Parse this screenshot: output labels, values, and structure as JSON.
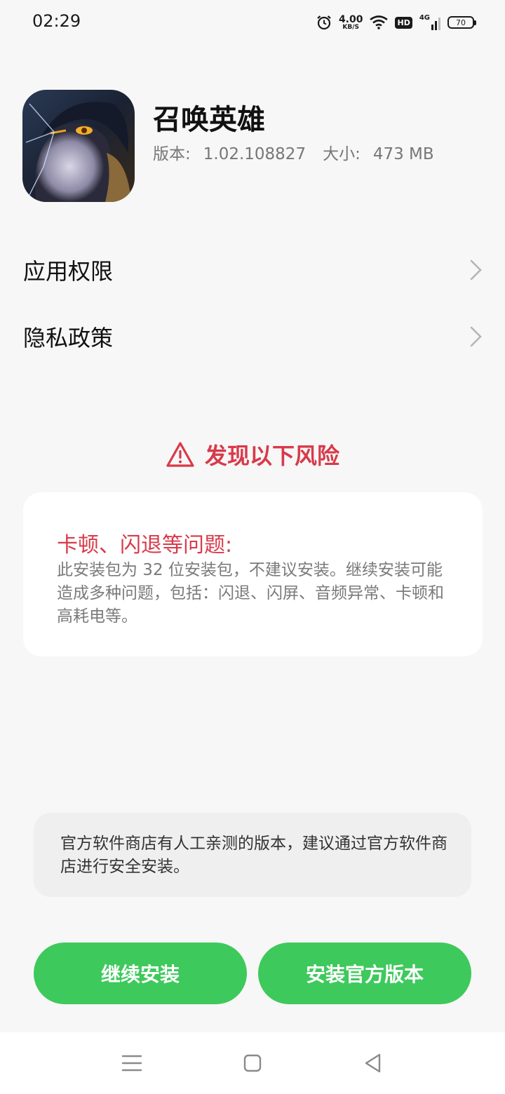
{
  "status_bar": {
    "time": "02:29",
    "net_speed_value": "4.00",
    "net_speed_unit": "KB/S",
    "hd_label": "HD",
    "network_type": "4G",
    "battery_level": "70",
    "icons": [
      "alarm-icon",
      "wifi-icon",
      "hd-icon",
      "cellular-signal-icon",
      "battery-icon"
    ]
  },
  "app": {
    "name": "召唤英雄",
    "version_label": "版本:",
    "version_value": "1.02.108827",
    "size_label": "大小:",
    "size_value": "473 MB",
    "icon": "app-icon"
  },
  "menu": {
    "permissions_label": "应用权限",
    "privacy_label": "隐私政策"
  },
  "risk": {
    "heading": "发现以下风险",
    "card_title": "卡顿、闪退等问题:",
    "card_desc": "此安装包为 32 位安装包，不建议安装。继续安装可能造成多种问题，包括：闪退、闪屏、音频异常、卡顿和高耗电等。",
    "accent_color": "#d83a4a"
  },
  "notice": {
    "text": "官方软件商店有人工亲测的版本，建议通过官方软件商店进行安全安装。"
  },
  "buttons": {
    "continue_label": "继续安装",
    "official_label": "安装官方版本",
    "color": "#3ec95c"
  },
  "nav": {
    "icons": [
      "menu-icon",
      "home-icon",
      "back-icon"
    ]
  }
}
